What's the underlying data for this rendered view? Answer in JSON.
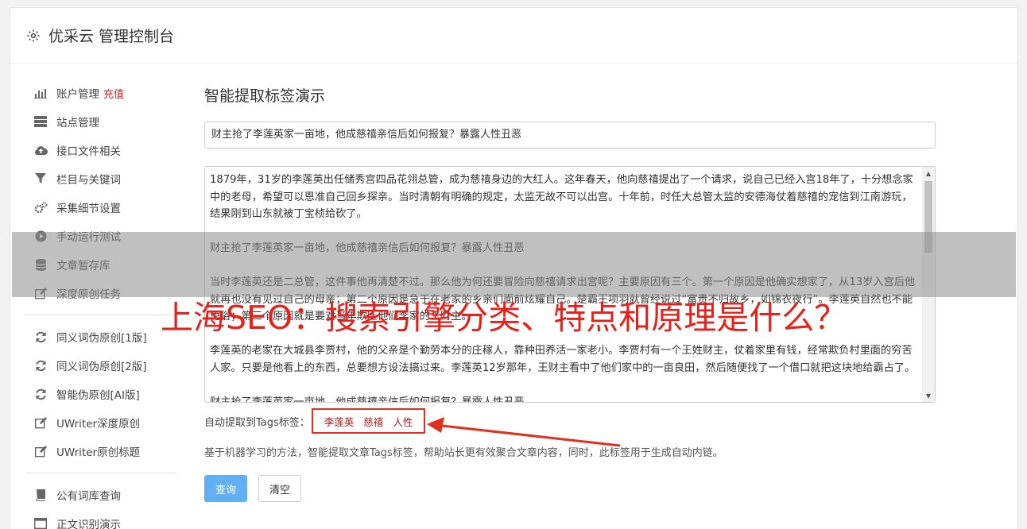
{
  "header": {
    "title": "优采云 管理控制台",
    "icon": "gear-icon"
  },
  "sidebar": {
    "group1": [
      {
        "label": "账户管理",
        "badge": "充值",
        "icon": "bar-chart-icon"
      },
      {
        "label": "站点管理",
        "icon": "server-icon"
      },
      {
        "label": "接口文件相关",
        "icon": "cloud-upload-icon"
      },
      {
        "label": "栏目与关键词",
        "icon": "filter-icon"
      },
      {
        "label": "采集细节设置",
        "icon": "gears-icon"
      },
      {
        "label": "手动运行测试",
        "icon": "play-circle-icon"
      },
      {
        "label": "文章暂存库",
        "icon": "database-icon"
      },
      {
        "label": "深度原创任务",
        "icon": "edit-icon"
      }
    ],
    "group2": [
      {
        "label": "同义词伪原创[1版]",
        "icon": "refresh-icon"
      },
      {
        "label": "同义词伪原创[2版]",
        "icon": "refresh-icon"
      },
      {
        "label": "智能伪原创[AI版]",
        "icon": "refresh-icon"
      },
      {
        "label": "UWriter深度原创",
        "icon": "edit-icon"
      },
      {
        "label": "UWriter原创标题",
        "icon": "edit-icon"
      }
    ],
    "group3": [
      {
        "label": "公有词库查询",
        "icon": "book-icon"
      },
      {
        "label": "正文识别演示",
        "icon": "window-icon"
      }
    ]
  },
  "main": {
    "title": "智能提取标签演示",
    "title_input_value": "财主抢了李莲英家一亩地，他成慈禧亲信后如何报复？暴露人性丑恶",
    "body_text": "1879年，31岁的李莲英出任储秀宫四品花翎总管，成为慈禧身边的大红人。这年春天，他向慈禧提出了一个请求，说自己已经入宫18年了，十分想念家中的老母，希望可以恩准自己回乡探亲。当时清朝有明确的规定，太监无故不可以出宫。十年前，时任大总管太监的安德海仗着慈禧的宠信到江南游玩，结果刚到山东就被丁宝桢给砍了。\n\n财主抢了李莲英家一亩地，他成慈禧亲信后如何报复？暴露人性丑恶\n\n当时李莲英还是二总管，这件事他再清楚不过。那么他为何还要冒险向慈禧请求出宫呢？主要原因有三个。第一个原因是他确实想家了，从13岁入宫后他就再也没有见过自己的母亲；第二个原因是急于在老家的乡亲们面前炫耀自己。楚霸王项羽就曾经说过“富贵不归故乡，如锦衣夜行”。李莲英自然也不能免俗；第三个原因就是要对当年欺压他们李家的王财主。\n\n李莲英的老家在大城县李贾村，他的父亲是个勤劳本分的庄稼人，靠种田养活一家老小。李贾村有一个王姓财主，仗着家里有钱，经常欺负村里面的穷苦人家。只要是他看上的东西，总要想方设法搞过来。李莲英12岁那年，王财主看中了他们家中的一亩良田，然后随便找了一个借口就把这块地给霸占了。\n\n财主抢了李莲英家一亩地，他成慈禧亲信后如何报复？暴露人性丑恶",
    "tags_label": "自动提取到Tags标签：",
    "tags": [
      "李莲英",
      "慈禧",
      "人性"
    ],
    "description": "基于机器学习的方法，智能提取文章Tags标签，帮助站长更有效聚合文章内容，同时，此标签用于生成自动内链。",
    "query_button": "查询",
    "clear_button": "清空"
  },
  "overlay": {
    "headline": "上海SEO：搜索引擎分类、特点和原理是什么？",
    "headline_color": "#e8201a",
    "arrow_color": "#e0301e"
  }
}
